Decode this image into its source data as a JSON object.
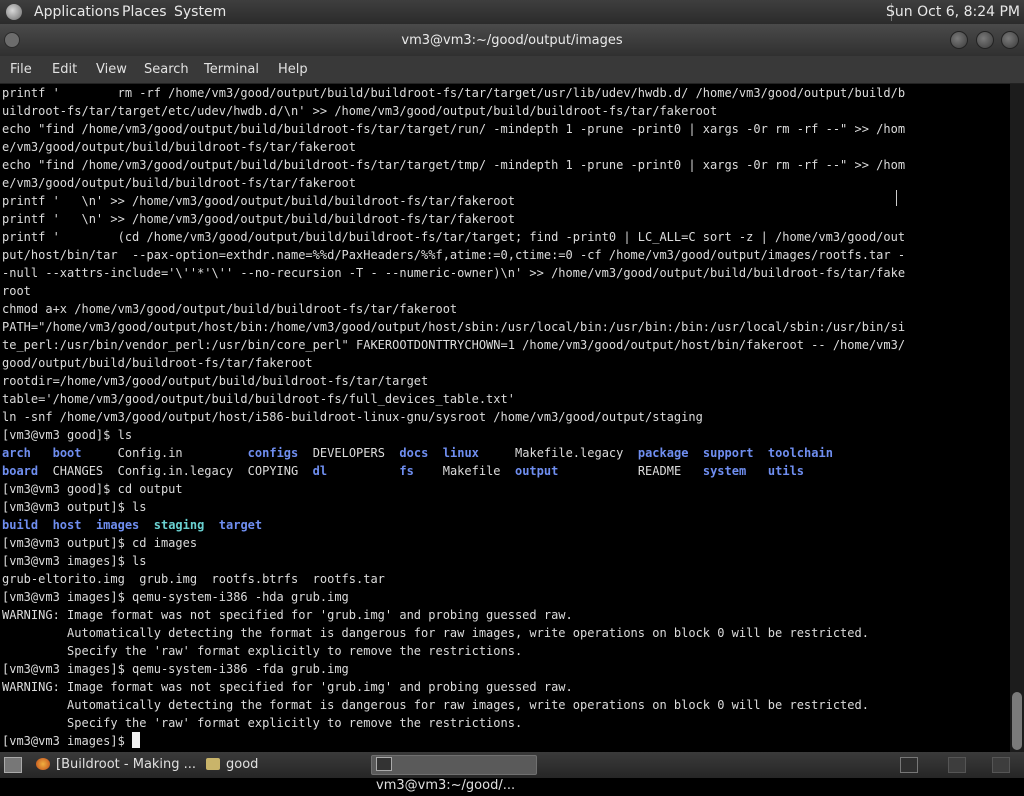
{
  "panel": {
    "menus": [
      "Applications",
      "Places",
      "System"
    ],
    "clock": "Sun Oct  6,  8:24 PM"
  },
  "window": {
    "title": "vm3@vm3:~/good/output/images"
  },
  "menubar": {
    "items": [
      "File",
      "Edit",
      "View",
      "Search",
      "Terminal",
      "Help"
    ]
  },
  "terminal": {
    "lines": [
      [
        [
          "printf '        rm -rf /home/vm3/good/output/build/buildroot-fs/tar/target/usr/lib/udev/hwdb.d/ /home/vm3/good/output/build/b",
          ""
        ]
      ],
      [
        [
          "uildroot-fs/tar/target/etc/udev/hwdb.d/\\n' >> /home/vm3/good/output/build/buildroot-fs/tar/fakeroot",
          ""
        ]
      ],
      [
        [
          "echo \"find /home/vm3/good/output/build/buildroot-fs/tar/target/run/ -mindepth 1 -prune -print0 | xargs -0r rm -rf --\" >> /hom",
          ""
        ]
      ],
      [
        [
          "e/vm3/good/output/build/buildroot-fs/tar/fakeroot",
          ""
        ]
      ],
      [
        [
          "echo \"find /home/vm3/good/output/build/buildroot-fs/tar/target/tmp/ -mindepth 1 -prune -print0 | xargs -0r rm -rf --\" >> /hom",
          ""
        ]
      ],
      [
        [
          "e/vm3/good/output/build/buildroot-fs/tar/fakeroot",
          ""
        ]
      ],
      [
        [
          "printf '   \\n' >> /home/vm3/good/output/build/buildroot-fs/tar/fakeroot",
          ""
        ]
      ],
      [
        [
          "printf '   \\n' >> /home/vm3/good/output/build/buildroot-fs/tar/fakeroot",
          ""
        ]
      ],
      [
        [
          "printf '        (cd /home/vm3/good/output/build/buildroot-fs/tar/target; find -print0 | LC_ALL=C sort -z | /home/vm3/good/out",
          ""
        ]
      ],
      [
        [
          "put/host/bin/tar  --pax-option=exthdr.name=%%d/PaxHeaders/%%f,atime:=0,ctime:=0 -cf /home/vm3/good/output/images/rootfs.tar -",
          ""
        ]
      ],
      [
        [
          "-null --xattrs-include='\\''*'\\'' --no-recursion -T - --numeric-owner)\\n' >> /home/vm3/good/output/build/buildroot-fs/tar/fake",
          ""
        ]
      ],
      [
        [
          "root",
          ""
        ]
      ],
      [
        [
          "chmod a+x /home/vm3/good/output/build/buildroot-fs/tar/fakeroot",
          ""
        ]
      ],
      [
        [
          "PATH=\"/home/vm3/good/output/host/bin:/home/vm3/good/output/host/sbin:/usr/local/bin:/usr/bin:/bin:/usr/local/sbin:/usr/bin/si",
          ""
        ]
      ],
      [
        [
          "te_perl:/usr/bin/vendor_perl:/usr/bin/core_perl\" FAKEROOTDONTTRYCHOWN=1 /home/vm3/good/output/host/bin/fakeroot -- /home/vm3/",
          ""
        ]
      ],
      [
        [
          "good/output/build/buildroot-fs/tar/fakeroot",
          ""
        ]
      ],
      [
        [
          "rootdir=/home/vm3/good/output/build/buildroot-fs/tar/target",
          ""
        ]
      ],
      [
        [
          "table='/home/vm3/good/output/build/buildroot-fs/full_devices_table.txt'",
          ""
        ]
      ],
      [
        [
          "ln -snf /home/vm3/good/output/host/i586-buildroot-linux-gnu/sysroot /home/vm3/good/output/staging",
          ""
        ]
      ],
      [
        [
          "[vm3@vm3 good]$ ls",
          ""
        ]
      ],
      [
        [
          "arch",
          "b"
        ],
        [
          "   ",
          ""
        ],
        [
          "boot",
          "b"
        ],
        [
          "     Config.in         ",
          ""
        ],
        [
          "configs",
          "b"
        ],
        [
          "  DEVELOPERS  ",
          ""
        ],
        [
          "docs",
          "b"
        ],
        [
          "  ",
          ""
        ],
        [
          "linux",
          "b"
        ],
        [
          "     Makefile.legacy  ",
          ""
        ],
        [
          "package",
          "b"
        ],
        [
          "  ",
          ""
        ],
        [
          "support",
          "b"
        ],
        [
          "  ",
          ""
        ],
        [
          "toolchain",
          "b"
        ]
      ],
      [
        [
          "board",
          "b"
        ],
        [
          "  CHANGES  Config.in.legacy  COPYING  ",
          ""
        ],
        [
          "dl",
          "b"
        ],
        [
          "          ",
          ""
        ],
        [
          "fs",
          "b"
        ],
        [
          "    Makefile  ",
          ""
        ],
        [
          "output",
          "b"
        ],
        [
          "           README   ",
          ""
        ],
        [
          "system",
          "b"
        ],
        [
          "   ",
          ""
        ],
        [
          "utils",
          "b"
        ]
      ],
      [
        [
          "[vm3@vm3 good]$ cd output",
          ""
        ]
      ],
      [
        [
          "[vm3@vm3 output]$ ls",
          ""
        ]
      ],
      [
        [
          "build",
          "b"
        ],
        [
          "  ",
          ""
        ],
        [
          "host",
          "b"
        ],
        [
          "  ",
          ""
        ],
        [
          "images",
          "b"
        ],
        [
          "  ",
          ""
        ],
        [
          "staging",
          "t"
        ],
        [
          "  ",
          ""
        ],
        [
          "target",
          "b"
        ]
      ],
      [
        [
          "[vm3@vm3 output]$ cd images",
          ""
        ]
      ],
      [
        [
          "[vm3@vm3 images]$ ls",
          ""
        ]
      ],
      [
        [
          "grub-eltorito.img  grub.img  rootfs.btrfs  rootfs.tar",
          ""
        ]
      ],
      [
        [
          "[vm3@vm3 images]$ qemu-system-i386 -hda grub.img",
          ""
        ]
      ],
      [
        [
          "WARNING: Image format was not specified for 'grub.img' and probing guessed raw.",
          ""
        ]
      ],
      [
        [
          "         Automatically detecting the format is dangerous for raw images, write operations on block 0 will be restricted.",
          ""
        ]
      ],
      [
        [
          "         Specify the 'raw' format explicitly to remove the restrictions.",
          ""
        ]
      ],
      [
        [
          "[vm3@vm3 images]$ qemu-system-i386 -fda grub.img",
          ""
        ]
      ],
      [
        [
          "WARNING: Image format was not specified for 'grub.img' and probing guessed raw.",
          ""
        ]
      ],
      [
        [
          "         Automatically detecting the format is dangerous for raw images, write operations on block 0 will be restricted.",
          ""
        ]
      ],
      [
        [
          "         Specify the 'raw' format explicitly to remove the restrictions.",
          ""
        ]
      ],
      [
        [
          "[vm3@vm3 images]$ ",
          ""
        ]
      ]
    ]
  },
  "taskbar": {
    "tasks": [
      {
        "label": "[Buildroot - Making ...",
        "icon": "firefox-icon"
      },
      {
        "label": "good",
        "icon": "folder-icon"
      },
      {
        "label": "vm3@vm3:~/good/...",
        "icon": "terminal-icon"
      }
    ]
  },
  "colors": {
    "directory": "#6f8ef0",
    "symlink": "#6ad2d2",
    "text": "#dcdcdc",
    "background": "#000000"
  }
}
